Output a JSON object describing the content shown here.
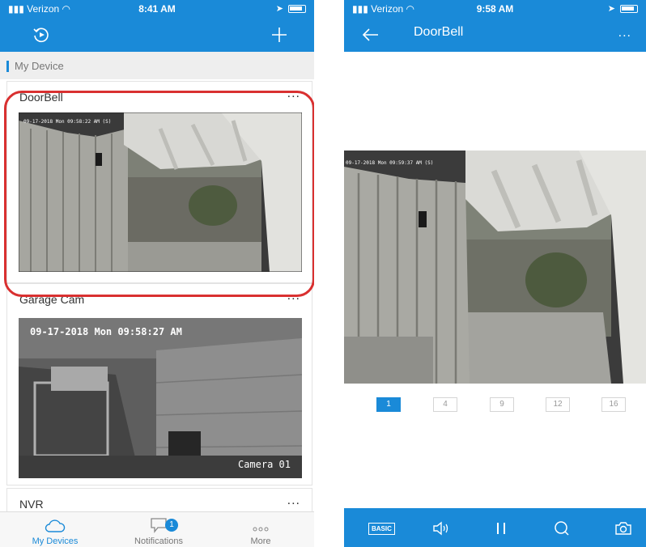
{
  "left": {
    "status": {
      "carrier": "Verizon",
      "time": "8:41 AM"
    },
    "section_label": "My Device",
    "devices": [
      {
        "name": "DoorBell",
        "more": "...",
        "osd": "09-17-2018 Mon 09:58:22 AM (S)"
      },
      {
        "name": "Garage Cam",
        "more": "...",
        "osd": "09-17-2018 Mon 09:58:27 AM",
        "osd_label": "Camera 01"
      },
      {
        "name": "NVR",
        "more": "..."
      }
    ],
    "tabs": [
      {
        "label": "My Devices",
        "icon": "cloud-icon"
      },
      {
        "label": "Notifications",
        "icon": "chat-bubble-icon",
        "badge": "1"
      },
      {
        "label": "More",
        "icon": "dots-icon"
      }
    ]
  },
  "right": {
    "status": {
      "carrier": "Verizon",
      "time": "9:58 AM"
    },
    "title": "DoorBell",
    "more": "...",
    "osd": "09-17-2018 Mon 09:59:37 AM (S)",
    "split_options": [
      "1",
      "4",
      "9",
      "12",
      "16"
    ],
    "selected_split": "1",
    "controls": {
      "basic_label": "BASIC"
    }
  },
  "colors": {
    "accent": "#1a8ad8",
    "highlight": "#d93030"
  }
}
